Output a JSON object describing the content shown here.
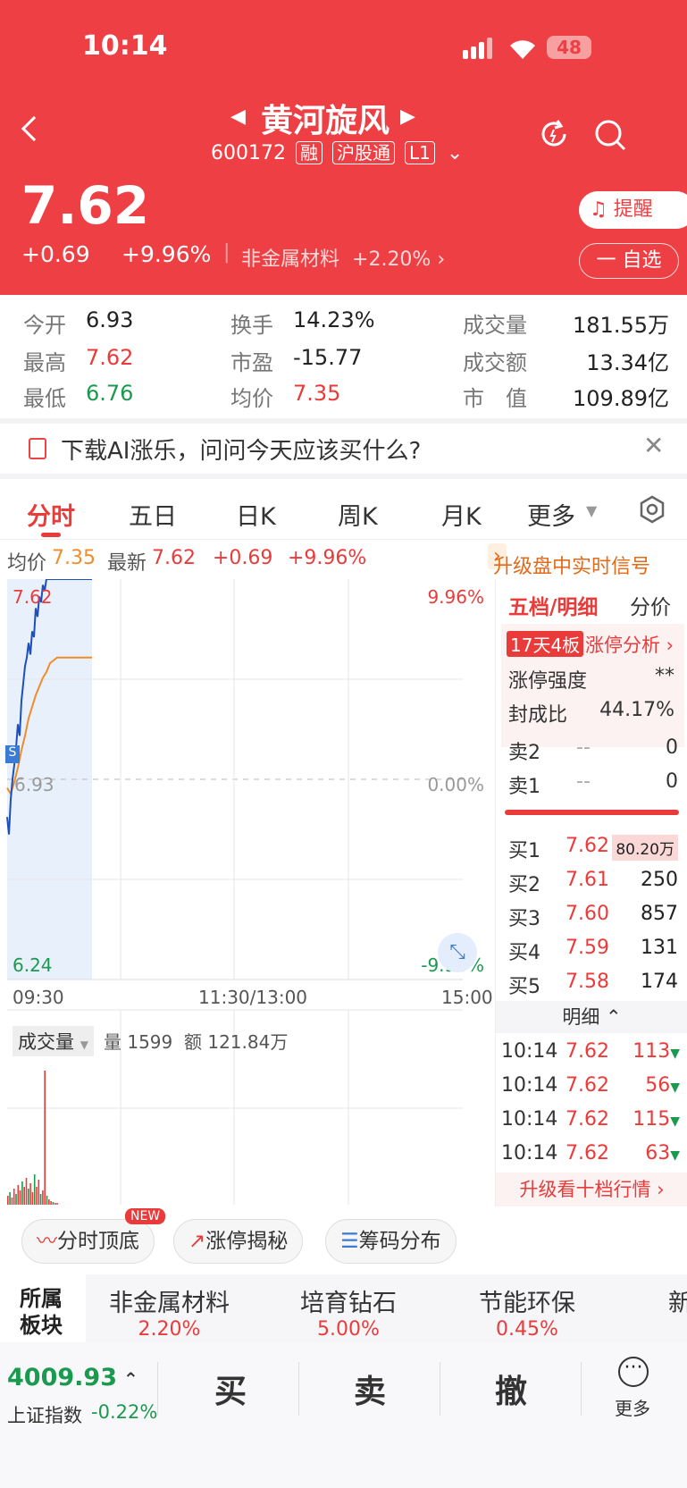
{
  "status": {
    "time": "10:14",
    "battery": "48"
  },
  "stock": {
    "name": "黄河旋风",
    "code": "600172",
    "tags": [
      "融",
      "沪股通",
      "L1"
    ],
    "price": "7.62",
    "change": "+0.69",
    "change_pct": "+9.96%",
    "sector": "非金属材料",
    "sector_change": "+2.20%"
  },
  "actions": {
    "alert": "提醒",
    "watchlist": "一 自选"
  },
  "stats": [
    {
      "label": "今开",
      "value": "6.93"
    },
    {
      "label": "换手",
      "value": "14.23%"
    },
    {
      "label": "成交量",
      "value": "181.55万"
    },
    {
      "label": "最高",
      "value": "7.62"
    },
    {
      "label": "市盈",
      "value": "-15.77"
    },
    {
      "label": "成交额",
      "value": "13.34亿"
    },
    {
      "label": "最低",
      "value": "6.76"
    },
    {
      "label": "均价",
      "value": "7.35"
    },
    {
      "label": "市　值",
      "value": "109.89亿"
    }
  ],
  "ai_banner": "下载AI涨乐，问问今天应该买什么?",
  "tabs": [
    "分时",
    "五日",
    "日K",
    "周K",
    "月K",
    "更多"
  ],
  "quote_line": {
    "avg_label": "均价",
    "avg": "7.35",
    "latest_label": "最新",
    "latest": "7.62",
    "chg": "+0.69",
    "pct": "+9.96%",
    "upgrade": "升级盘中实时信号"
  },
  "chart_data": {
    "type": "line",
    "y_left": {
      "top": "7.62",
      "mid": "6.93",
      "bottom": "6.24"
    },
    "y_right": {
      "top": "9.96%",
      "mid": "0.00%",
      "bottom": "-9.96%"
    },
    "x_labels": [
      "09:30",
      "11:30/13:00",
      "15:00"
    ],
    "price_series": {
      "x": [
        0,
        2,
        4,
        6,
        8,
        10,
        12,
        14,
        16,
        18,
        20,
        22,
        24,
        26,
        28,
        30,
        32,
        34,
        36,
        38,
        40,
        42,
        44,
        45,
        48,
        52,
        56,
        60,
        64,
        70,
        80,
        95
      ],
      "values": [
        6.8,
        6.74,
        6.86,
        6.93,
        6.98,
        7.04,
        7.12,
        7.08,
        7.2,
        7.26,
        7.32,
        7.35,
        7.4,
        7.36,
        7.44,
        7.42,
        7.52,
        7.49,
        7.56,
        7.54,
        7.6,
        7.58,
        7.62,
        7.62,
        7.62,
        7.62,
        7.62,
        7.62,
        7.62,
        7.62,
        7.62,
        7.62
      ]
    },
    "avg_series": {
      "x": [
        0,
        4,
        8,
        12,
        16,
        20,
        24,
        28,
        32,
        36,
        40,
        44,
        48,
        52,
        56,
        60,
        70,
        80,
        95
      ],
      "values": [
        6.9,
        6.88,
        6.92,
        6.97,
        7.03,
        7.08,
        7.14,
        7.18,
        7.22,
        7.25,
        7.28,
        7.3,
        7.33,
        7.34,
        7.35,
        7.35,
        7.35,
        7.35,
        7.35
      ]
    },
    "volume_label": "成交量",
    "vol_text": "量 1599",
    "amt_text": "额 121.84万"
  },
  "orderbook": {
    "tab1": "五档/明细",
    "tab2": "分价",
    "limit_tag": "17天4板",
    "limit_analysis": "涨停分析",
    "strength_label": "涨停强度",
    "strength": "**",
    "seal_label": "封成比",
    "seal": "44.17%",
    "sell": [
      {
        "l": "卖2",
        "p": "--",
        "v": "0"
      },
      {
        "l": "卖1",
        "p": "--",
        "v": "0"
      }
    ],
    "buy": [
      {
        "l": "买1",
        "p": "7.62",
        "v": "80.20万"
      },
      {
        "l": "买2",
        "p": "7.61",
        "v": "250"
      },
      {
        "l": "买3",
        "p": "7.60",
        "v": "857"
      },
      {
        "l": "买4",
        "p": "7.59",
        "v": "131"
      },
      {
        "l": "买5",
        "p": "7.58",
        "v": "174"
      }
    ],
    "detail_label": "明细",
    "ticks": [
      {
        "t": "10:14",
        "p": "7.62",
        "v": "113"
      },
      {
        "t": "10:14",
        "p": "7.62",
        "v": "56"
      },
      {
        "t": "10:14",
        "p": "7.62",
        "v": "115"
      },
      {
        "t": "10:14",
        "p": "7.62",
        "v": "63"
      }
    ],
    "upgrade10": "升级看十档行情"
  },
  "tools": [
    {
      "label": "分时顶底",
      "badge": "NEW"
    },
    {
      "label": "涨停揭秘"
    },
    {
      "label": "筹码分布"
    }
  ],
  "sectors": {
    "title": "所属板块",
    "items": [
      {
        "name": "非金属材料",
        "pct": "2.20%"
      },
      {
        "name": "培育钻石",
        "pct": "5.00%"
      },
      {
        "name": "节能环保",
        "pct": "0.45%"
      },
      {
        "name": "新"
      }
    ]
  },
  "bottom": {
    "index_value": "4009.93",
    "index_name": "上证指数",
    "index_chg": "-0.22%",
    "buy": "买",
    "sell": "卖",
    "cancel": "撤",
    "more": "更多"
  }
}
